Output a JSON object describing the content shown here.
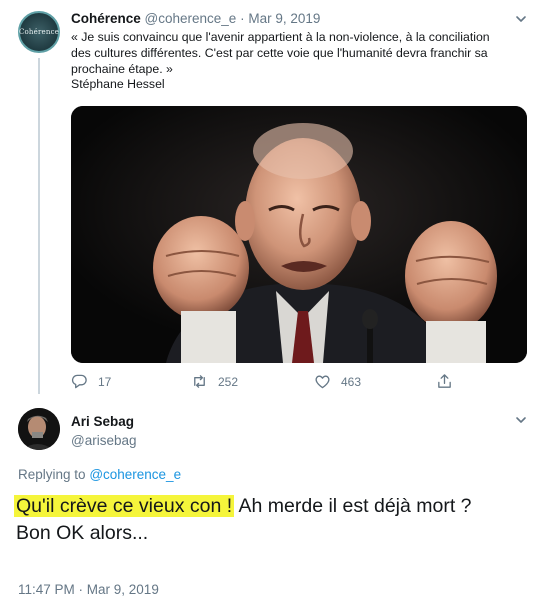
{
  "colors": {
    "link": "#1b95e0",
    "secondary_text": "#657786",
    "highlight": "#f5f53b",
    "thread_line": "#ccd6dd"
  },
  "tweet1": {
    "avatar_text": "Cohérence",
    "name": "Cohérence",
    "handle": "@coherence_e",
    "separator": "·",
    "date": "Mar 9, 2019",
    "text_lines": [
      "« Je suis convaincu que l'avenir appartient à la non-violence, à la conciliation",
      "des cultures différentes. C'est par cette voie que l'humanité devra franchir sa",
      "prochaine étape. »",
      "Stéphane Hessel"
    ],
    "replies": "17",
    "retweets": "252",
    "likes": "463",
    "icons": [
      "reply-icon",
      "retweet-icon",
      "like-icon",
      "share-icon",
      "chevron-down-icon"
    ]
  },
  "tweet2": {
    "name": "Ari Sebag",
    "handle": "@arisebag",
    "replying_label": "Replying to",
    "replying_to": "@coherence_e",
    "highlighted_text": "Qu'il crève ce vieux con !",
    "text_rest": " Ah merde il est déjà mort ?",
    "text_line2": "Bon OK alors...",
    "timestamp": "11:47 PM · Mar 9, 2019"
  }
}
